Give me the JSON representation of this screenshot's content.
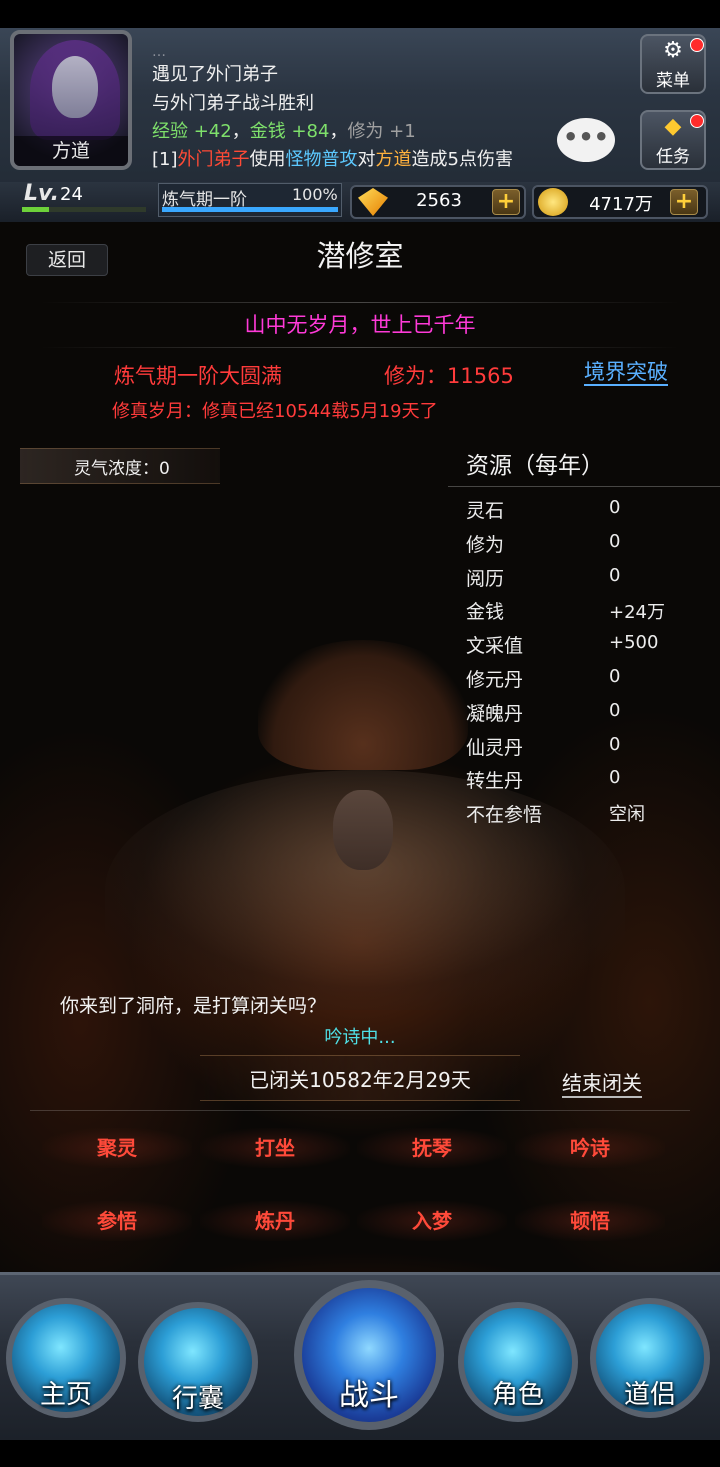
{
  "header": {
    "avatar_name": "方道",
    "log_faded": "…",
    "log_lines": {
      "line1": "遇见了外门弟子",
      "line2": "与外门弟子战斗胜利",
      "line3": {
        "exp": "经验 +42",
        "sep1": "，",
        "money": "金钱 +84",
        "sep2": "，",
        "cult": "修为 +1"
      },
      "line4": {
        "prefix": "[1]",
        "attacker": "外门弟子",
        "verb": "使用",
        "skill": "怪物普攻",
        "to": "对",
        "target": "方道",
        "result": "造成5点伤害"
      }
    },
    "chat_icon": "•••",
    "menu_label": "菜单",
    "task_label": "任务"
  },
  "stats": {
    "lv_label": "Lv.",
    "lv_value": "24",
    "lv_progress": 0.22,
    "realm_label": "炼气期一阶",
    "realm_pct": "100%",
    "gems": "2563",
    "gold": "4717万",
    "plus": "+"
  },
  "page": {
    "back_label": "返回",
    "title": "潜修室",
    "motto": "山中无岁月，世上已千年",
    "realm_full": "炼气期一阶大圆满",
    "cultivation": "修为：11565",
    "breakthrough_label": "境界突破",
    "years": "修真岁月：修真已经10544载5月19天了",
    "aura": "灵气浓度：0",
    "resources_title": "资源（每年）",
    "resources": [
      {
        "label": "灵石",
        "value": "0"
      },
      {
        "label": "修为",
        "value": "0"
      },
      {
        "label": "阅历",
        "value": "0"
      },
      {
        "label": "金钱",
        "value": "+24万"
      },
      {
        "label": "文采值",
        "value": "+500"
      },
      {
        "label": "修元丹",
        "value": "0"
      },
      {
        "label": "凝魄丹",
        "value": "0"
      },
      {
        "label": "仙灵丹",
        "value": "0"
      },
      {
        "label": "转生丹",
        "value": "0"
      },
      {
        "label": "不在参悟",
        "value": "空闲"
      }
    ],
    "dialog": "你来到了洞府，是打算闭关吗？",
    "chanting": "吟诗中...",
    "retreat_time": "已闭关10582年2月29天",
    "end_retreat_label": "结束闭关",
    "actions": [
      "聚灵",
      "打坐",
      "抚琴",
      "吟诗",
      "参悟",
      "炼丹",
      "入梦",
      "顿悟"
    ]
  },
  "nav": {
    "items": [
      "主页",
      "行囊",
      "战斗",
      "角色",
      "道侣"
    ]
  },
  "colors": {
    "motto": "#ff3ad8",
    "realm_red": "#ff3b3b",
    "breakthrough_blue": "#5ab0ff",
    "chant_cyan": "#4fe1e8",
    "action_red": "#ff4a3a"
  }
}
